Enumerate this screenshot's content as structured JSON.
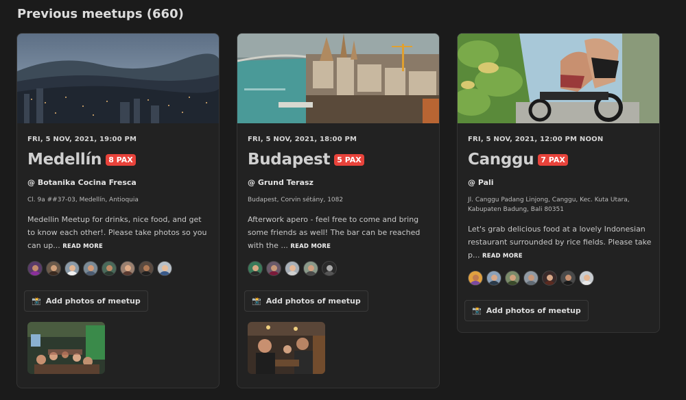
{
  "header": {
    "title": "Previous meetups (660)"
  },
  "meetups": [
    {
      "date": "FRI, 5 NOV, 2021, 19:00 PM",
      "city": "Medellín",
      "pax": "8 PAX",
      "venue": "@ Botanika Cocina Fresca",
      "address": "Cl. 9a ##37-03, Medellín, Antioquia",
      "description": "Medellin Meetup for drinks, nice food, and get to know each other!. Please take photos so you can up... ",
      "read_more": "READ MORE",
      "add_photos": "Add photos of meetup",
      "avatar_count": 8,
      "has_photo": true
    },
    {
      "date": "FRI, 5 NOV, 2021, 18:00 PM",
      "city": "Budapest",
      "pax": "5 PAX",
      "venue": "@ Grund Terasz",
      "address": "Budapest, Corvin sétány, 1082",
      "description": "Afterwork apero - feel free to come and bring some friends as well! The bar can be reached with the ... ",
      "read_more": "READ MORE",
      "add_photos": "Add photos of meetup",
      "avatar_count": 5,
      "has_photo": true
    },
    {
      "date": "FRI, 5 NOV, 2021, 12:00 PM NOON",
      "city": "Canggu",
      "pax": "7 PAX",
      "venue": "@ Pali",
      "address": "Jl. Canggu Padang Linjong, Canggu, Kec. Kuta Utara, Kabupaten Badung, Bali 80351",
      "description": "Let's grab delicious food at a lovely Indonesian restaurant surrounded by rice fields. Please take p... ",
      "read_more": "READ MORE",
      "add_photos": "Add photos of meetup",
      "avatar_count": 7,
      "has_photo": false
    }
  ],
  "icons": {
    "camera": "camera-icon"
  },
  "colors": {
    "background": "#1b1b1b",
    "card": "#222222",
    "pax_badge": "#e8433b"
  }
}
